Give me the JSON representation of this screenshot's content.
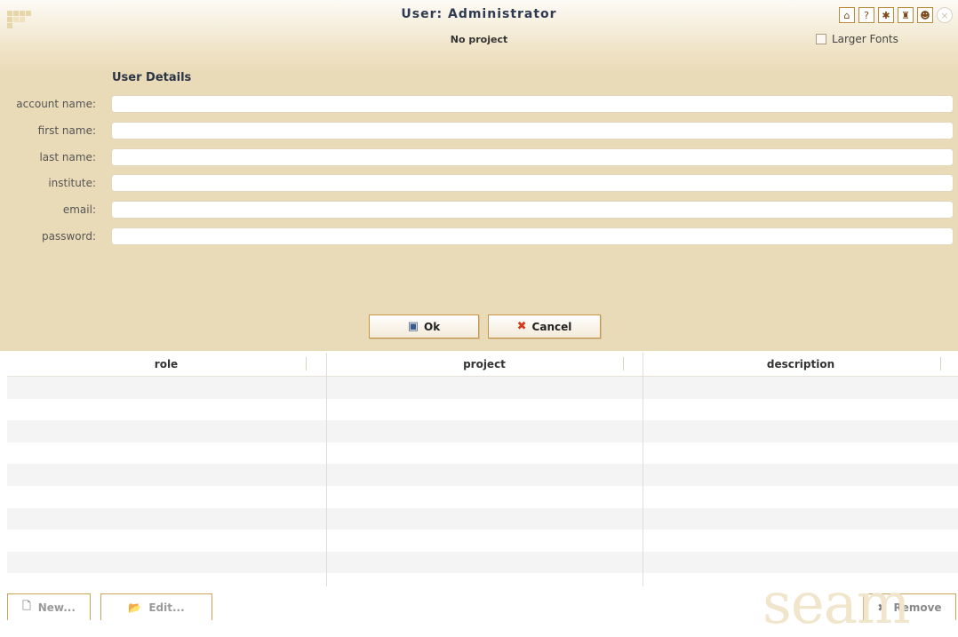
{
  "header": {
    "title": "User: Administrator",
    "subtitle": "No project",
    "larger_fonts_label": "Larger Fonts",
    "icons": [
      "home-icon",
      "help-icon",
      "bug-icon",
      "bug-report-icon",
      "users-icon",
      "close-icon"
    ]
  },
  "form": {
    "section_title": "User Details",
    "fields": [
      {
        "label": "account name:",
        "value": ""
      },
      {
        "label": "first name:",
        "value": ""
      },
      {
        "label": "last name:",
        "value": ""
      },
      {
        "label": "institute:",
        "value": ""
      },
      {
        "label": "email:",
        "value": ""
      },
      {
        "label": "password:",
        "value": ""
      }
    ],
    "ok_label": "Ok",
    "cancel_label": "Cancel"
  },
  "table": {
    "columns": [
      "role",
      "project",
      "description"
    ],
    "rows": []
  },
  "footer": {
    "new_label": "New...",
    "edit_label": "Edit...",
    "remove_label": "Remove",
    "watermark": "seam"
  },
  "colors": {
    "header_bg": "#eadbb8",
    "button_border": "#c89547",
    "title_color": "#2e3a52"
  }
}
